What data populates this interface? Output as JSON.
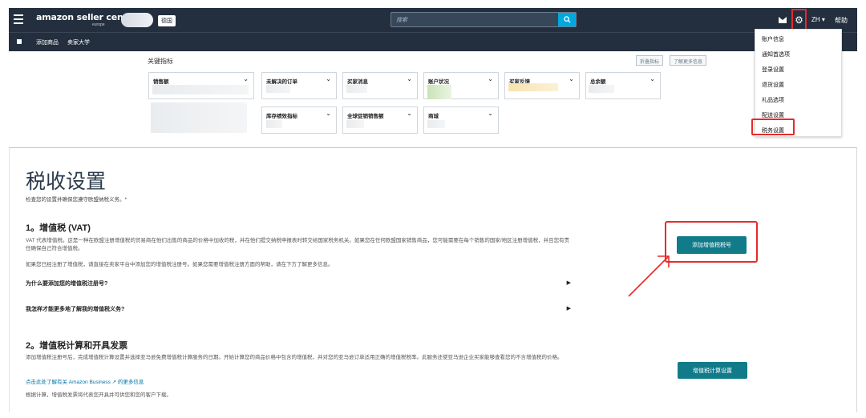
{
  "header": {
    "logo_text": "amazon seller central",
    "logo_sub": "europe",
    "marketplace": "德国",
    "search_placeholder": "搜索",
    "language": "ZH ▾",
    "help": "帮助"
  },
  "subnav": {
    "items": [
      "添加商品",
      "卖家大学"
    ]
  },
  "settings_menu": {
    "items": [
      "账户信息",
      "通知首选项",
      "登录设置",
      "退货设置",
      "礼品选项",
      "配送设置",
      "税务设置"
    ]
  },
  "key_metrics": {
    "title": "关键指标",
    "collapse_btn": "折叠指标",
    "learn_more_btn": "了解更多信息",
    "cards_row1": [
      "销售额",
      "未解决的订单",
      "买家消息",
      "账户状况",
      "买家反馈",
      "总余额"
    ],
    "cards_row2": [
      "库存绩效指标",
      "全球促销销售额",
      "商城"
    ]
  },
  "page": {
    "title": "税收设置",
    "intro": "检查您的设置并确保您遵守欧盟纳税义务。*",
    "vat": {
      "heading": "1。增值税 (VAT)",
      "para1": "VAT 代表增值税。这是一种在欧盟注册增值税的贸易商在他们出售的商品的价格中加收的税，并在他们提交纳税申报表时转交给国家税务机关。如果您在任何欧盟国家销售商品，您可能需要在每个销售的国家/地区注册增值税，并且您有责任确保自己符合增值税。",
      "para2": "如果您已经注册了增值税，请直接在卖家平台中添加您的增值税注册号。如果您需要增值税注册方面的帮助，请在下方了解更多信息。",
      "q1": "为什么要添加您的增值税注册号?",
      "q2": "我怎样才能更多地了解我的增值税义务?",
      "button": "添加增值税税号"
    },
    "calc": {
      "heading": "2。增值税计算和开具发票",
      "para1": "添加增值税注册号后，完成增值税计算设置并选择亚马逊免费增值税计算服务的日期。开始计算您的商品价格中包含的增值税，并对您的亚马逊订单适用正确的增值税税率。此服务还使亚马逊企业买家能够查看您的不含增值税的价格。",
      "link": "点击此处了解有关 Amazon Business ↗ 的更多信息",
      "para2": "根据计算，增值税发票将代表您开具并可供您和您的客户下载。",
      "button": "增值税计算设置"
    }
  },
  "colors": {
    "header_bg": "#232f3e",
    "accent": "#117b8a",
    "highlight": "#e62a2a"
  }
}
